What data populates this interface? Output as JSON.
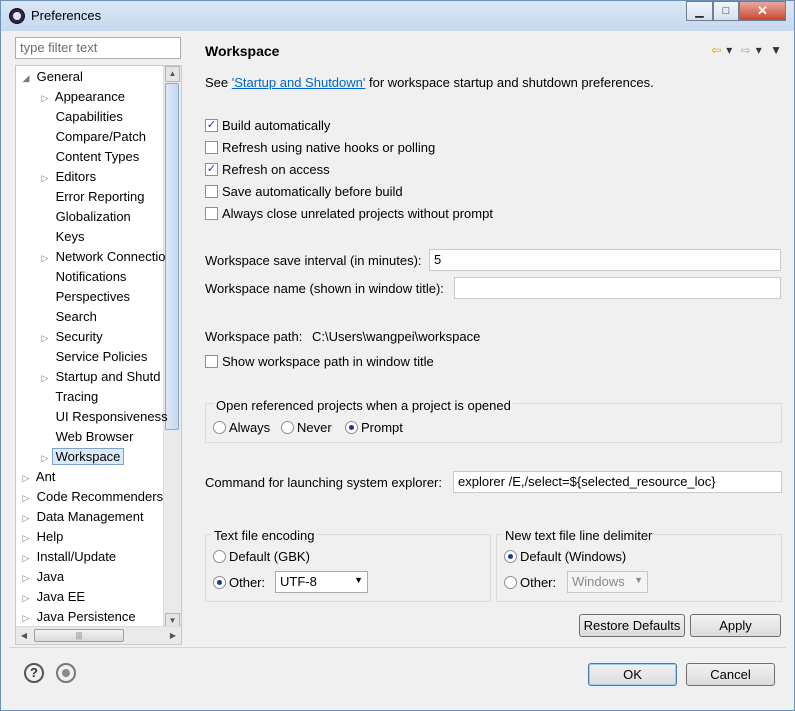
{
  "window": {
    "title": "Preferences",
    "minimize_glyph": "▁",
    "maximize_glyph": "□",
    "close_glyph": "✕"
  },
  "sidebar": {
    "filter_placeholder": "type filter text",
    "tree": [
      {
        "label": "General",
        "expanded": true,
        "level": 0
      },
      {
        "label": "Appearance",
        "has_children": true,
        "level": 1
      },
      {
        "label": "Capabilities",
        "level": 1
      },
      {
        "label": "Compare/Patch",
        "level": 1
      },
      {
        "label": "Content Types",
        "level": 1
      },
      {
        "label": "Editors",
        "has_children": true,
        "level": 1
      },
      {
        "label": "Error Reporting",
        "level": 1
      },
      {
        "label": "Globalization",
        "level": 1
      },
      {
        "label": "Keys",
        "level": 1
      },
      {
        "label": "Network Connectio",
        "has_children": true,
        "level": 1
      },
      {
        "label": "Notifications",
        "level": 1
      },
      {
        "label": "Perspectives",
        "level": 1
      },
      {
        "label": "Search",
        "level": 1
      },
      {
        "label": "Security",
        "has_children": true,
        "level": 1
      },
      {
        "label": "Service Policies",
        "level": 1
      },
      {
        "label": "Startup and Shutd",
        "has_children": true,
        "level": 1
      },
      {
        "label": "Tracing",
        "level": 1
      },
      {
        "label": "UI Responsiveness",
        "level": 1
      },
      {
        "label": "Web Browser",
        "level": 1
      },
      {
        "label": "Workspace",
        "has_children": true,
        "level": 1,
        "selected": true
      },
      {
        "label": "Ant",
        "has_children": true,
        "level": 0
      },
      {
        "label": "Code Recommenders",
        "has_children": true,
        "level": 0
      },
      {
        "label": "Data Management",
        "has_children": true,
        "level": 0
      },
      {
        "label": "Help",
        "has_children": true,
        "level": 0
      },
      {
        "label": "Install/Update",
        "has_children": true,
        "level": 0
      },
      {
        "label": "Java",
        "has_children": true,
        "level": 0
      },
      {
        "label": "Java EE",
        "has_children": true,
        "level": 0
      },
      {
        "label": "Java Persistence",
        "has_children": true,
        "level": 0
      }
    ]
  },
  "page": {
    "title": "Workspace",
    "intro_prefix": "See ",
    "intro_link": "'Startup and Shutdown'",
    "intro_suffix": " for workspace startup and shutdown preferences.",
    "checkboxes": {
      "build_auto": {
        "label": "Build automatically",
        "checked": true
      },
      "refresh_native": {
        "label": "Refresh using native hooks or polling",
        "checked": false
      },
      "refresh_access": {
        "label": "Refresh on access",
        "checked": true
      },
      "save_auto": {
        "label": "Save automatically before build",
        "checked": false
      },
      "always_close": {
        "label": "Always close unrelated projects without prompt",
        "checked": false
      }
    },
    "save_interval_label": "Workspace save interval (in minutes):",
    "save_interval_value": "5",
    "workspace_name_label": "Workspace name (shown in window title):",
    "workspace_name_value": "",
    "workspace_path_label": "Workspace path:",
    "workspace_path_value": "C:\\Users\\wangpei\\workspace",
    "show_path_label": "Show workspace path in window title",
    "open_ref_group": {
      "title": "Open referenced projects when a project is opened",
      "options": [
        "Always",
        "Never",
        "Prompt"
      ],
      "selected": "Prompt"
    },
    "explorer_label": "Command for launching system explorer:",
    "explorer_value": "explorer /E,/select=${selected_resource_loc}",
    "encoding_group": {
      "title": "Text file encoding",
      "default_label": "Default (GBK)",
      "other_label": "Other:",
      "other_value": "UTF-8",
      "selected": "Other"
    },
    "delimiter_group": {
      "title": "New text file line delimiter",
      "default_label": "Default (Windows)",
      "other_label": "Other:",
      "other_value": "Windows",
      "selected": "Default"
    },
    "restore_defaults_label": "Restore Defaults",
    "apply_label": "Apply"
  },
  "footer": {
    "ok_label": "OK",
    "cancel_label": "Cancel"
  }
}
